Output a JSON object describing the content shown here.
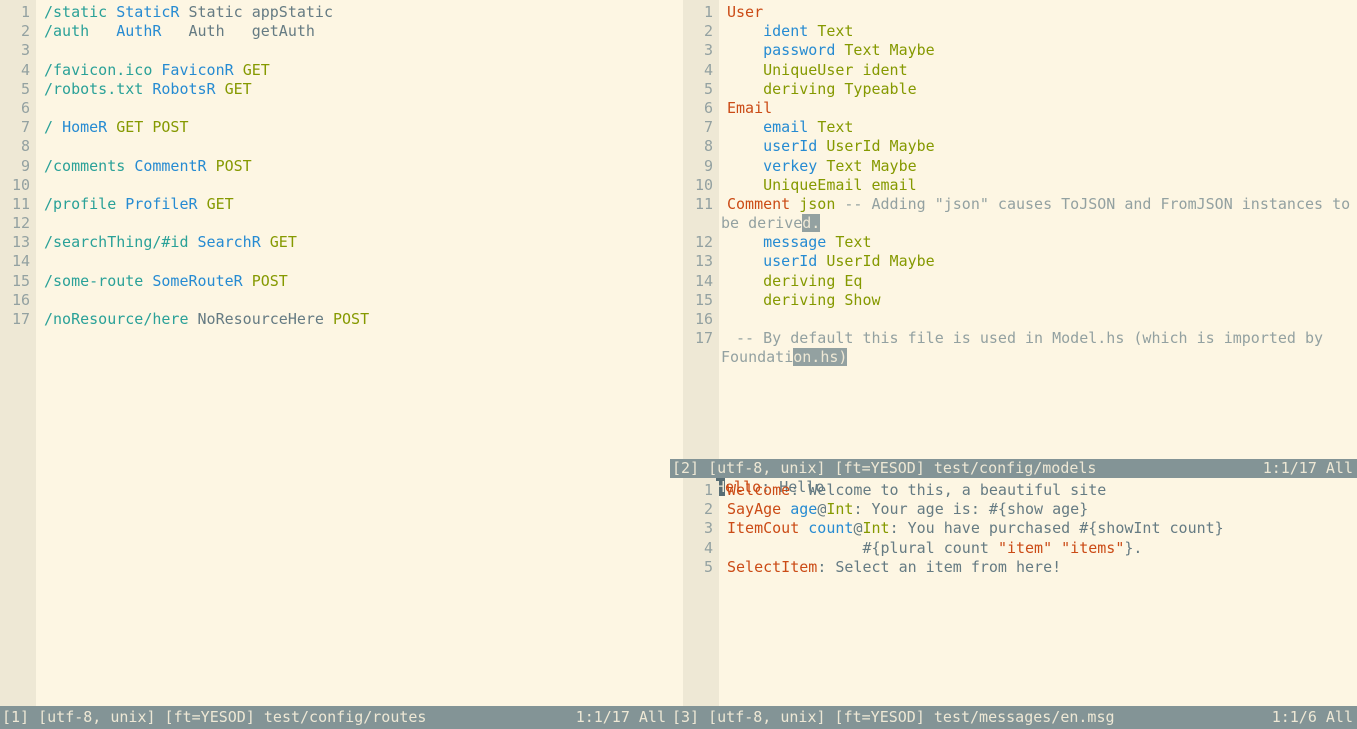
{
  "app": "vim",
  "theme": {
    "background": "#fdf6e3",
    "gutter_background": "#eee8d5",
    "foreground": "#657b83",
    "statusline_background": "#839496",
    "statusline_foreground": "#eee8d5",
    "split_divider": "#91a4a6",
    "search_highlight_background": "#93a1a1",
    "cursor_background": "#586e75",
    "accent_route": "#2aa198",
    "accent_identifier": "#268bd2",
    "accent_keyword": "#859900",
    "accent_entity": "#cb4b16",
    "accent_comment": "#93a1a1"
  },
  "windows": {
    "routes": {
      "id": "[1]",
      "statusline": {
        "window_number": "[1]",
        "encoding": "[utf-8, unix]",
        "filetype": "[ft=YESOD]",
        "filename": "test/config/routes",
        "position": "1:1/17",
        "scroll": "All"
      },
      "total_lines": 17,
      "lines": [
        {
          "n": "1",
          "tokens": [
            {
              "t": "/static ",
              "c": "s-route"
            },
            {
              "t": "StaticR ",
              "c": "s-ident"
            },
            {
              "t": "Static appStatic",
              "c": "s-plain"
            }
          ]
        },
        {
          "n": "2",
          "tokens": [
            {
              "t": "/auth   ",
              "c": "s-route"
            },
            {
              "t": "AuthR   ",
              "c": "s-ident"
            },
            {
              "t": "Auth   getAuth",
              "c": "s-plain"
            }
          ]
        },
        {
          "n": "3",
          "tokens": []
        },
        {
          "n": "4",
          "tokens": [
            {
              "t": "/favicon.ico ",
              "c": "s-route"
            },
            {
              "t": "FaviconR ",
              "c": "s-ident"
            },
            {
              "t": "GET",
              "c": "s-method"
            }
          ]
        },
        {
          "n": "5",
          "tokens": [
            {
              "t": "/robots.txt ",
              "c": "s-route"
            },
            {
              "t": "RobotsR ",
              "c": "s-ident"
            },
            {
              "t": "GET",
              "c": "s-method"
            }
          ]
        },
        {
          "n": "6",
          "tokens": []
        },
        {
          "n": "7",
          "tokens": [
            {
              "t": "/ ",
              "c": "s-route"
            },
            {
              "t": "HomeR ",
              "c": "s-ident"
            },
            {
              "t": "GET POST",
              "c": "s-method"
            }
          ]
        },
        {
          "n": "8",
          "tokens": []
        },
        {
          "n": "9",
          "tokens": [
            {
              "t": "/comments ",
              "c": "s-route"
            },
            {
              "t": "CommentR ",
              "c": "s-ident"
            },
            {
              "t": "POST",
              "c": "s-method"
            }
          ]
        },
        {
          "n": "10",
          "tokens": []
        },
        {
          "n": "11",
          "tokens": [
            {
              "t": "/profile ",
              "c": "s-route"
            },
            {
              "t": "ProfileR ",
              "c": "s-ident"
            },
            {
              "t": "GET",
              "c": "s-method"
            }
          ]
        },
        {
          "n": "12",
          "tokens": []
        },
        {
          "n": "13",
          "tokens": [
            {
              "t": "/searchThing/#id ",
              "c": "s-route"
            },
            {
              "t": "SearchR ",
              "c": "s-ident"
            },
            {
              "t": "GET",
              "c": "s-method"
            }
          ]
        },
        {
          "n": "14",
          "tokens": []
        },
        {
          "n": "15",
          "tokens": [
            {
              "t": "/some-route ",
              "c": "s-route"
            },
            {
              "t": "SomeRouteR ",
              "c": "s-ident"
            },
            {
              "t": "POST",
              "c": "s-method"
            }
          ]
        },
        {
          "n": "16",
          "tokens": []
        },
        {
          "n": "17",
          "tokens": [
            {
              "t": "/noResource/here ",
              "c": "s-route"
            },
            {
              "t": "NoResourceHere ",
              "c": "s-plain"
            },
            {
              "t": "POST",
              "c": "s-method"
            }
          ]
        }
      ],
      "filler_rows": 20,
      "filler_char": "~"
    },
    "models": {
      "id": "[2]",
      "statusline": {
        "window_number": "[2]",
        "encoding": "[utf-8, unix]",
        "filetype": "[ft=YESOD]",
        "filename": "test/config/models",
        "position": "1:1/17",
        "scroll": "All"
      },
      "total_lines": 17,
      "lines": [
        {
          "n": "1",
          "tokens": [
            {
              "t": "User",
              "c": "s-entity"
            }
          ]
        },
        {
          "n": "2",
          "tokens": [
            {
              "t": "    ",
              "c": "s-plain"
            },
            {
              "t": "ident ",
              "c": "s-ident"
            },
            {
              "t": "Text",
              "c": "s-method"
            }
          ]
        },
        {
          "n": "3",
          "tokens": [
            {
              "t": "    ",
              "c": "s-plain"
            },
            {
              "t": "password ",
              "c": "s-ident"
            },
            {
              "t": "Text Maybe",
              "c": "s-method"
            }
          ]
        },
        {
          "n": "4",
          "tokens": [
            {
              "t": "    ",
              "c": "s-plain"
            },
            {
              "t": "UniqueUser ident",
              "c": "s-method"
            }
          ]
        },
        {
          "n": "5",
          "tokens": [
            {
              "t": "    ",
              "c": "s-plain"
            },
            {
              "t": "deriving Typeable",
              "c": "s-method"
            }
          ]
        },
        {
          "n": "6",
          "tokens": [
            {
              "t": "Email",
              "c": "s-entity"
            }
          ]
        },
        {
          "n": "7",
          "tokens": [
            {
              "t": "    ",
              "c": "s-plain"
            },
            {
              "t": "email ",
              "c": "s-ident"
            },
            {
              "t": "Text",
              "c": "s-method"
            }
          ]
        },
        {
          "n": "8",
          "tokens": [
            {
              "t": "    ",
              "c": "s-plain"
            },
            {
              "t": "userId ",
              "c": "s-ident"
            },
            {
              "t": "UserId Maybe",
              "c": "s-method"
            }
          ]
        },
        {
          "n": "9",
          "tokens": [
            {
              "t": "    ",
              "c": "s-plain"
            },
            {
              "t": "verkey ",
              "c": "s-ident"
            },
            {
              "t": "Text Maybe",
              "c": "s-method"
            }
          ]
        },
        {
          "n": "10",
          "tokens": [
            {
              "t": "    ",
              "c": "s-plain"
            },
            {
              "t": "UniqueEmail email",
              "c": "s-method"
            }
          ]
        },
        {
          "n": "11",
          "tokens": [
            {
              "t": "Comment ",
              "c": "s-entity"
            },
            {
              "t": "json ",
              "c": "s-method"
            },
            {
              "t": "-- Adding \"json\" causes ToJSON and FromJSON instances to",
              "c": "s-comment"
            }
          ],
          "wrap": [
            {
              "t": "be derive",
              "c": "s-comment"
            },
            {
              "t": "d.",
              "c": "s-comment hl"
            }
          ]
        },
        {
          "n": "12",
          "tokens": [
            {
              "t": "    ",
              "c": "s-plain"
            },
            {
              "t": "message ",
              "c": "s-ident"
            },
            {
              "t": "Text",
              "c": "s-method"
            }
          ]
        },
        {
          "n": "13",
          "tokens": [
            {
              "t": "    ",
              "c": "s-plain"
            },
            {
              "t": "userId ",
              "c": "s-ident"
            },
            {
              "t": "UserId Maybe",
              "c": "s-method"
            }
          ]
        },
        {
          "n": "14",
          "tokens": [
            {
              "t": "    ",
              "c": "s-plain"
            },
            {
              "t": "deriving Eq",
              "c": "s-method"
            }
          ]
        },
        {
          "n": "15",
          "tokens": [
            {
              "t": "    ",
              "c": "s-plain"
            },
            {
              "t": "deriving Show",
              "c": "s-method"
            }
          ]
        },
        {
          "n": "16",
          "tokens": []
        },
        {
          "n": "17",
          "tokens": [
            {
              "t": " -- By default this file is used in Model.hs (which is imported by",
              "c": "s-comment"
            }
          ],
          "wrap": [
            {
              "t": "Foundati",
              "c": "s-comment"
            },
            {
              "t": "on.hs)",
              "c": "s-comment hl"
            }
          ]
        }
      ],
      "filler_rows": 5,
      "filler_char": "~"
    },
    "messages": {
      "id": "[3]",
      "statusline": {
        "window_number": "[3]",
        "encoding": "[utf-8, unix]",
        "filetype": "[ft=YESOD]",
        "filename": "test/messages/en.msg",
        "position": "1:1/6",
        "scroll": "All"
      },
      "total_lines": 6,
      "cursor_line": "1",
      "cursor_char": "H",
      "first_line": {
        "n": "1",
        "cursor_char": "H",
        "tokens": [
          {
            "t": "ello",
            "c": "s-entity"
          },
          {
            "t": ": ",
            "c": "s-punct"
          },
          {
            "t": "Hello",
            "c": "s-plain"
          }
        ]
      },
      "lines": [
        {
          "n": "1",
          "tokens": [
            {
              "t": "Welcome",
              "c": "s-entity"
            },
            {
              "t": ": ",
              "c": "s-punct"
            },
            {
              "t": "Welcome to this, a beautiful site",
              "c": "s-plain"
            }
          ]
        },
        {
          "n": "2",
          "tokens": [
            {
              "t": "SayAge ",
              "c": "s-entity"
            },
            {
              "t": "age",
              "c": "s-ident"
            },
            {
              "t": "@",
              "c": "s-punct"
            },
            {
              "t": "Int",
              "c": "s-method"
            },
            {
              "t": ": Your age is: ",
              "c": "s-plain"
            },
            {
              "t": "#{show age}",
              "c": "s-plain"
            }
          ]
        },
        {
          "n": "3",
          "tokens": [
            {
              "t": "ItemCout ",
              "c": "s-entity"
            },
            {
              "t": "count",
              "c": "s-ident"
            },
            {
              "t": "@",
              "c": "s-punct"
            },
            {
              "t": "Int",
              "c": "s-method"
            },
            {
              "t": ": You have purchased ",
              "c": "s-plain"
            },
            {
              "t": "#{showInt count}",
              "c": "s-plain"
            }
          ]
        },
        {
          "n": "4",
          "tokens": [
            {
              "t": "               ",
              "c": "s-plain"
            },
            {
              "t": "#{plural count ",
              "c": "s-plain"
            },
            {
              "t": "\"item\" \"items\"",
              "c": "s-str"
            },
            {
              "t": "}.",
              "c": "s-plain"
            }
          ]
        },
        {
          "n": "5",
          "tokens": [
            {
              "t": "SelectItem",
              "c": "s-entity"
            },
            {
              "t": ": ",
              "c": "s-punct"
            },
            {
              "t": "Select an item from here!",
              "c": "s-plain"
            }
          ]
        }
      ],
      "filler_rows": 6,
      "filler_char": "~"
    }
  }
}
